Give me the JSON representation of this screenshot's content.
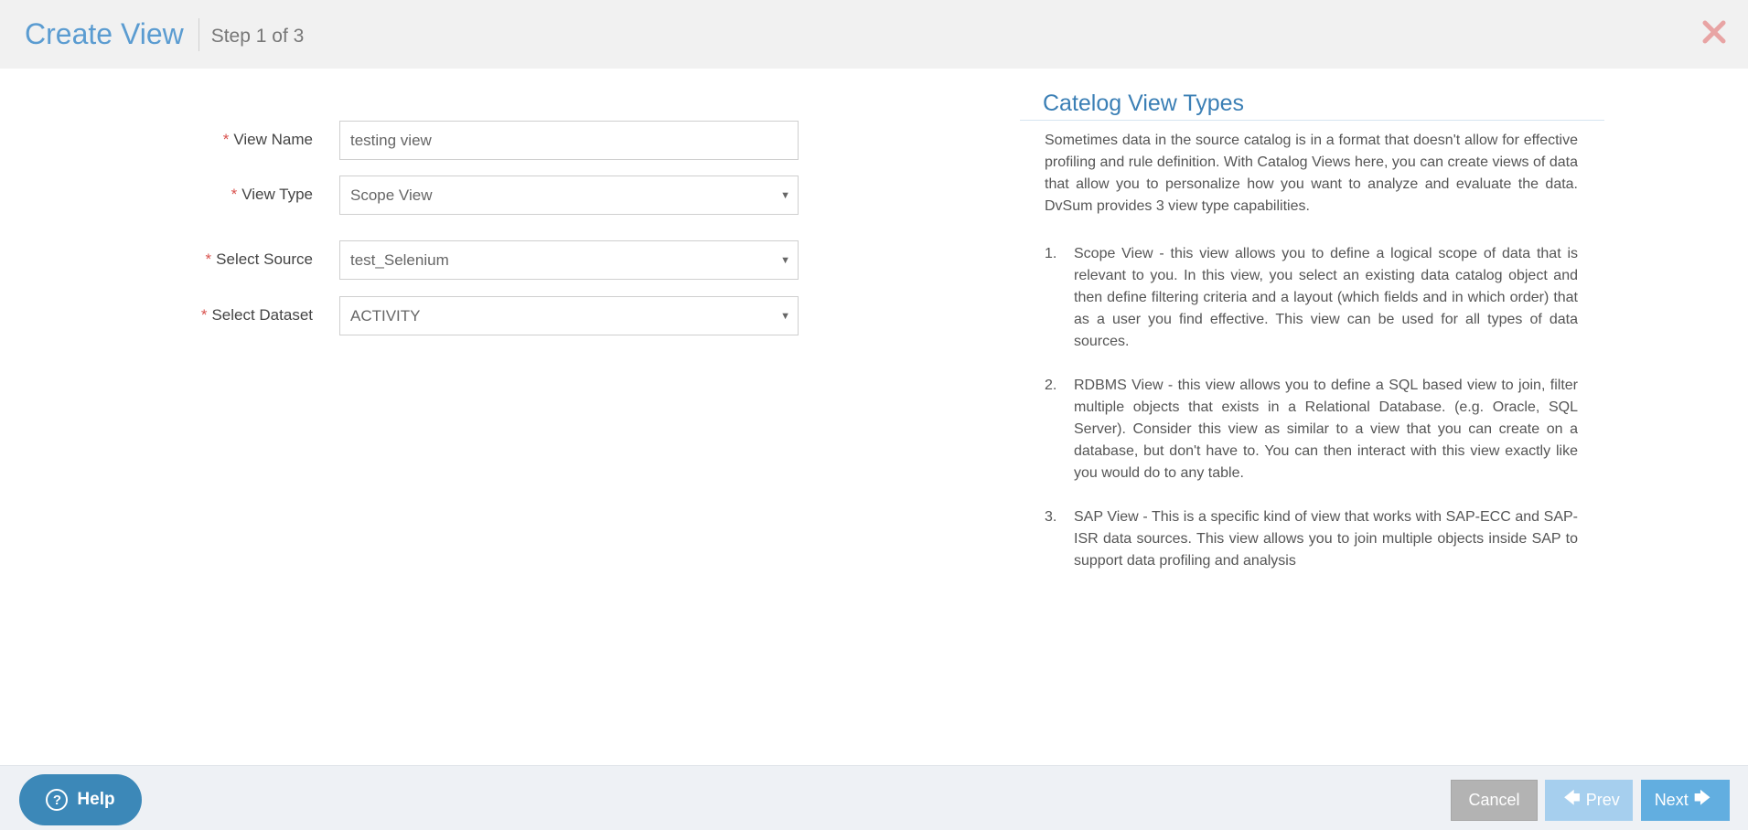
{
  "header": {
    "title": "Create View",
    "step": "Step 1 of 3"
  },
  "form": {
    "required_marker": "*",
    "view_name": {
      "label": "View Name",
      "value": "testing view"
    },
    "view_type": {
      "label": "View Type",
      "value": "Scope View"
    },
    "select_source": {
      "label": "Select Source",
      "value": "test_Selenium"
    },
    "select_dataset": {
      "label": "Select Dataset",
      "value": "ACTIVITY"
    }
  },
  "info": {
    "title": "Catelog View Types",
    "intro": "Sometimes data in the source catalog is in a format that doesn't allow for effective profiling and rule definition. With Catalog Views here, you can create views of data that allow you to personalize how you want to analyze and evaluate the data. DvSum provides 3 view type capabilities.",
    "items": [
      {
        "num": "1.",
        "text": "Scope View - this view allows you to define a logical scope of data that is relevant to you. In this view, you select an existing data catalog object and then define filtering criteria and a layout (which fields and in which order) that as a user you find effective. This view can be used for all types of data sources."
      },
      {
        "num": "2.",
        "text": "RDBMS View - this view allows you to define a SQL based view to join, filter multiple objects that exists in a Relational Database. (e.g. Oracle, SQL Server). Consider this view as similar to a view that you can create on a database, but don't have to. You can then interact with this view exactly like you would do to any table."
      },
      {
        "num": "3.",
        "text": "SAP View - This is a specific kind of view that works with SAP-ECC and SAP-ISR data sources. This view allows you to join multiple objects inside SAP to support data profiling and analysis"
      }
    ]
  },
  "footer": {
    "help_label": "Help",
    "cancel_label": "Cancel",
    "prev_label": "Prev",
    "next_label": "Next"
  },
  "colors": {
    "title": "#5b9cd1",
    "info_title": "#3b7fb5",
    "required": "#d9534f",
    "help_button": "#3c88b8",
    "cancel_button": "#b3b3b3",
    "prev_button": "#a6cfee",
    "next_button": "#62aee0",
    "close_icon": "#e8a4a4"
  },
  "icons": {
    "close": "close-icon",
    "help": "question-circle-icon",
    "prev": "arrow-left-icon",
    "next": "arrow-right-icon",
    "dropdown": "caret-down-icon"
  }
}
